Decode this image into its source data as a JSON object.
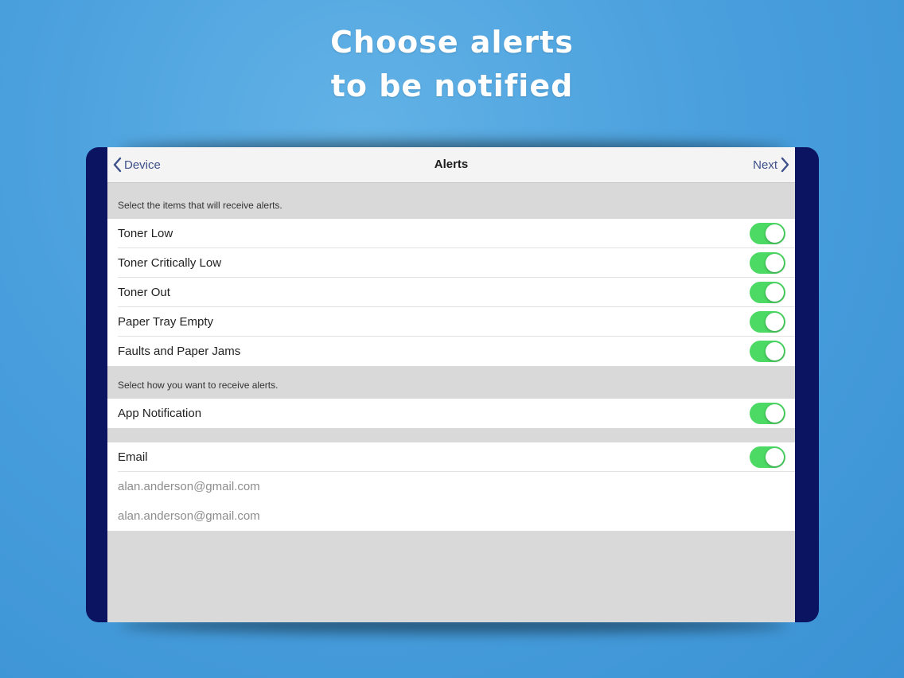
{
  "headline": {
    "line1": "Choose alerts",
    "line2": "to be notified"
  },
  "navbar": {
    "back_label": "Device",
    "title": "Alerts",
    "next_label": "Next"
  },
  "alert_items": {
    "header": "Select the items that will receive alerts.",
    "items": [
      {
        "label": "Toner Low",
        "enabled": true
      },
      {
        "label": "Toner Critically Low",
        "enabled": true
      },
      {
        "label": "Toner Out",
        "enabled": true
      },
      {
        "label": "Paper Tray Empty",
        "enabled": true
      },
      {
        "label": "Faults and Paper Jams",
        "enabled": true
      }
    ]
  },
  "delivery": {
    "header": "Select how you want to receive alerts.",
    "app_notification": {
      "label": "App Notification",
      "enabled": true
    },
    "email": {
      "label": "Email",
      "enabled": true
    },
    "addresses": [
      "alan.anderson@gmail.com",
      "alan.anderson@gmail.com"
    ]
  },
  "colors": {
    "toggle_on": "#4cd964",
    "bezel": "#0b1460",
    "nav_tint": "#3d4f8a"
  }
}
